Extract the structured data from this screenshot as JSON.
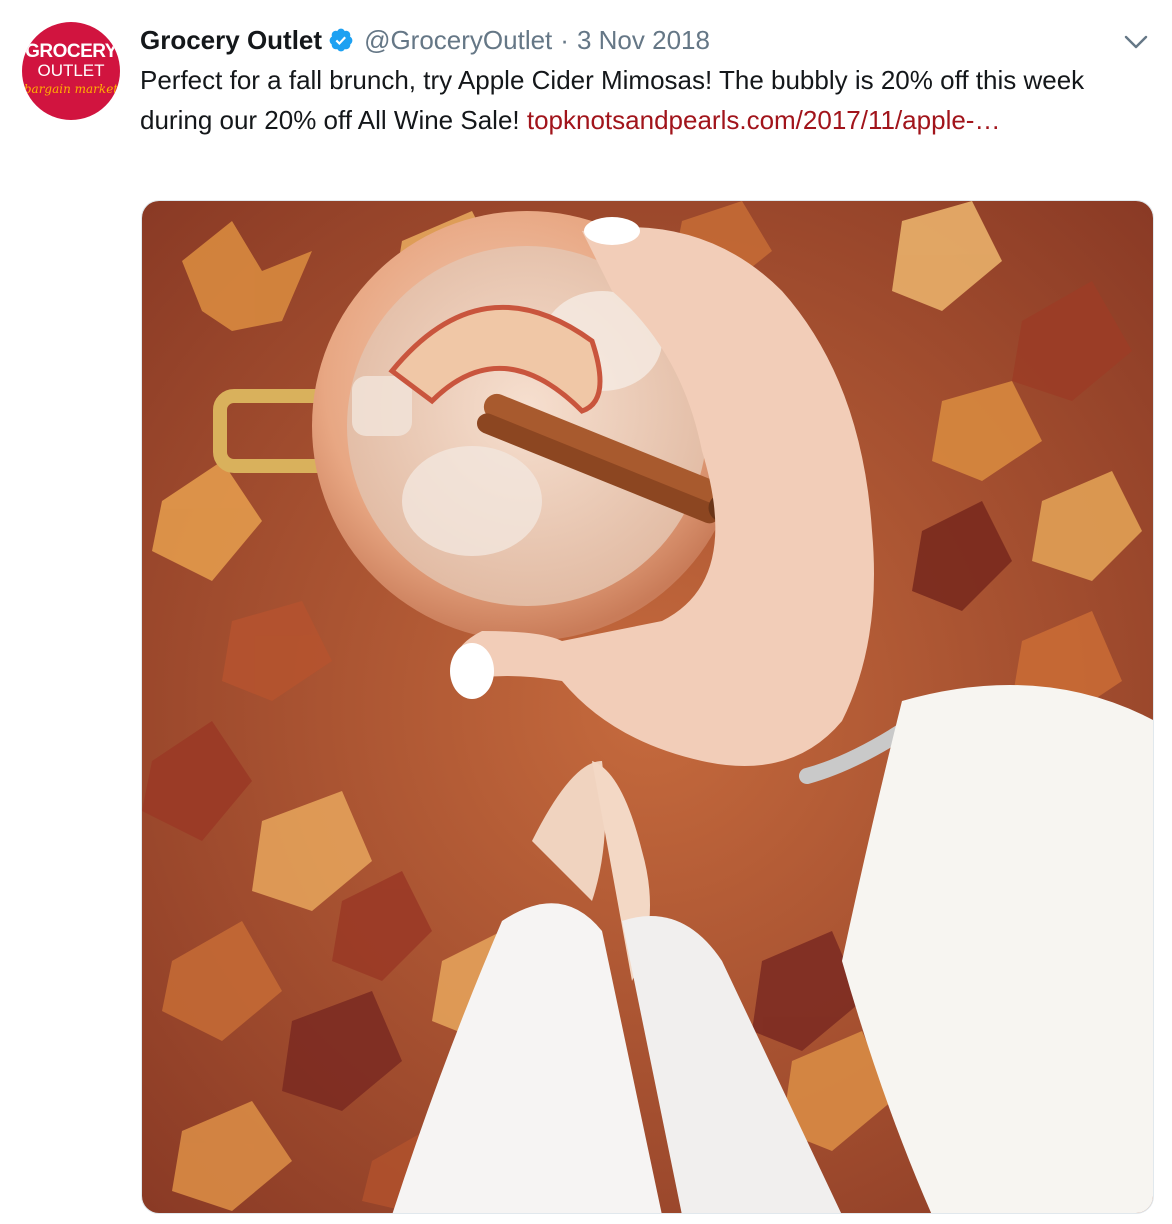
{
  "tweet": {
    "author": {
      "name": "Grocery Outlet",
      "handle": "@GroceryOutlet",
      "avatar_text": {
        "line1": "GROCERY",
        "line2": "OUTLET",
        "line3": "bargain market"
      }
    },
    "separator": "·",
    "date": "3 Nov 2018",
    "text_part1": "Perfect for a fall brunch, try Apple Cider Mimosas!  The bubbly is 20% off this week during our 20% off All Wine Sale!  ",
    "link": "topknotsandpearls.com/2017/11/apple-…",
    "icons": {
      "verified": "verified-badge-icon",
      "more": "chevron-down-icon"
    },
    "media": {
      "icon": "photo"
    }
  },
  "colors": {
    "brand_red": "#d1143f",
    "link": "#a1141b",
    "verified_blue": "#1da1f2",
    "muted": "#657786"
  }
}
